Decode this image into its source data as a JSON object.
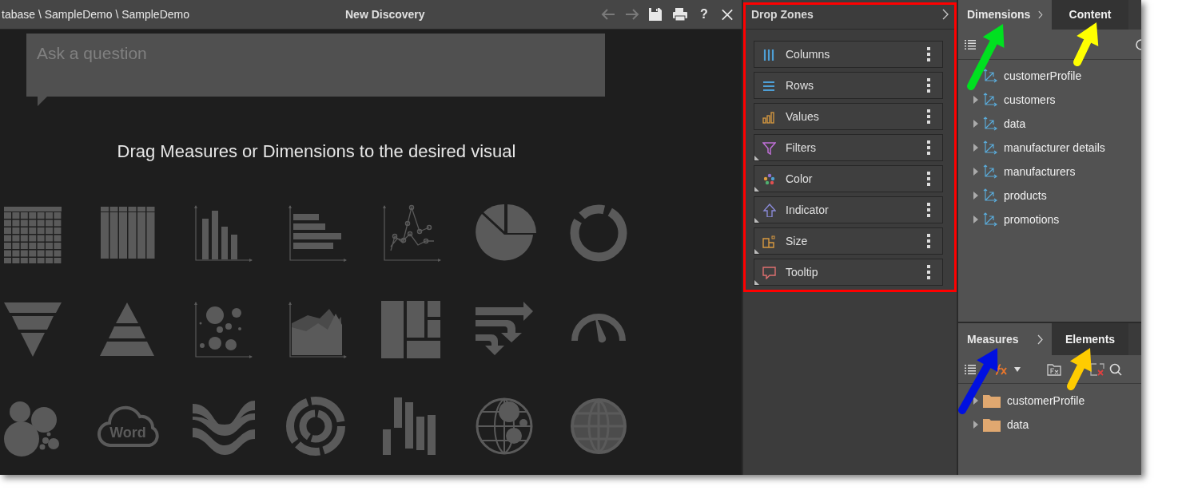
{
  "window": {
    "breadcrumb": "tabase \\ SampleDemo \\ SampleDemo",
    "title": "New Discovery",
    "toolbar": [
      {
        "kind": "back",
        "disabled": true
      },
      {
        "kind": "forward",
        "disabled": true
      },
      {
        "kind": "save",
        "disabled": false
      },
      {
        "kind": "print",
        "disabled": false
      },
      {
        "kind": "help",
        "label": "?",
        "disabled": false
      },
      {
        "kind": "close",
        "disabled": false
      }
    ]
  },
  "question": {
    "placeholder": "Ask a question"
  },
  "hint": "Drag Measures or Dimensions to the desired visual",
  "visuals": [
    {
      "kind": "grid"
    },
    {
      "kind": "columns"
    },
    {
      "kind": "bar"
    },
    {
      "kind": "hbar"
    },
    {
      "kind": "line"
    },
    {
      "kind": "pie"
    },
    {
      "kind": "donut"
    },
    {
      "kind": "funnel"
    },
    {
      "kind": "pyramid"
    },
    {
      "kind": "bubble"
    },
    {
      "kind": "area"
    },
    {
      "kind": "treemap"
    },
    {
      "kind": "flow"
    },
    {
      "kind": "gauge"
    },
    {
      "kind": "pack"
    },
    {
      "kind": "wordcloud",
      "label": "Word"
    },
    {
      "kind": "sankey"
    },
    {
      "kind": "sunburst"
    },
    {
      "kind": "floating"
    },
    {
      "kind": "geobubble"
    },
    {
      "kind": "globe"
    }
  ],
  "drop_zones": {
    "title": "Drop Zones",
    "items": [
      {
        "kind": "columns",
        "label": "Columns",
        "corner_mark": false
      },
      {
        "kind": "rows",
        "label": "Rows",
        "corner_mark": false
      },
      {
        "kind": "values",
        "label": "Values",
        "corner_mark": false
      },
      {
        "kind": "filters",
        "label": "Filters",
        "corner_mark": true
      },
      {
        "kind": "color",
        "label": "Color",
        "corner_mark": true
      },
      {
        "kind": "indicator",
        "label": "Indicator",
        "corner_mark": true
      },
      {
        "kind": "size",
        "label": "Size",
        "corner_mark": true
      },
      {
        "kind": "tooltip",
        "label": "Tooltip",
        "corner_mark": true
      }
    ]
  },
  "dimensions_panel": {
    "tabs": [
      {
        "label": "Dimensions",
        "selected": true
      },
      {
        "label": "Content",
        "selected": false
      }
    ],
    "items": [
      {
        "label": "customerProfile",
        "expandable": false
      },
      {
        "label": "customers",
        "expandable": true
      },
      {
        "label": "data",
        "expandable": true
      },
      {
        "label": "manufacturer details",
        "expandable": true
      },
      {
        "label": "manufacturers",
        "expandable": true
      },
      {
        "label": "products",
        "expandable": true
      },
      {
        "label": "promotions",
        "expandable": true
      }
    ]
  },
  "measures_panel": {
    "tabs": [
      {
        "label": "Measures",
        "selected": true
      },
      {
        "label": "Elements",
        "selected": false
      }
    ],
    "items": [
      {
        "label": "customerProfile",
        "expandable": true
      },
      {
        "label": "data",
        "expandable": true
      }
    ]
  },
  "annotations": [
    {
      "color": "#00e020"
    },
    {
      "color": "#ffff00"
    },
    {
      "color": "#0010e0"
    },
    {
      "color": "#ffcc00"
    }
  ]
}
